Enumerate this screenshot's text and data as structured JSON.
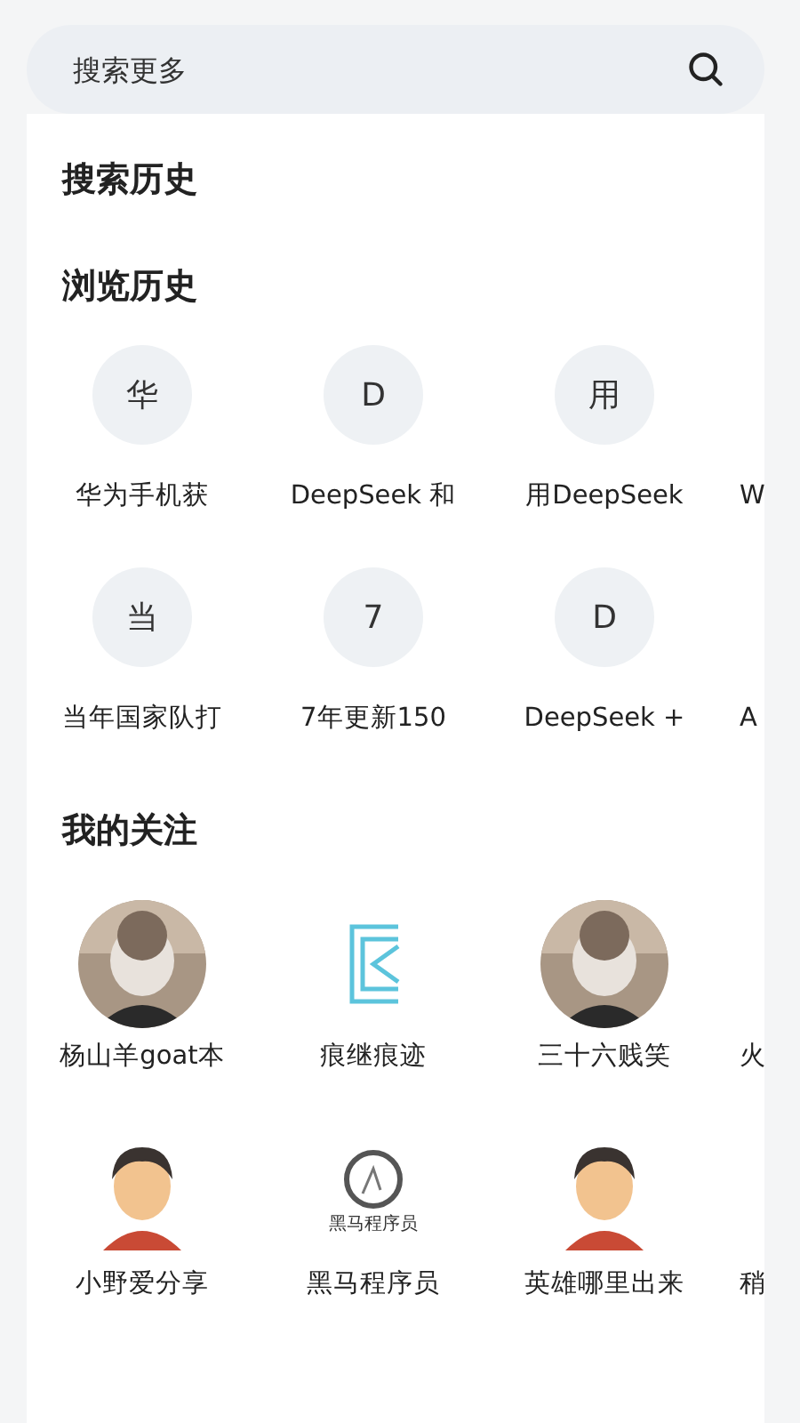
{
  "search": {
    "placeholder": "搜索更多"
  },
  "search_history": {
    "title": "搜索历史"
  },
  "browse_history": {
    "title": "浏览历史",
    "rows": [
      [
        {
          "initial": "华",
          "label": "华为手机获"
        },
        {
          "initial": "D",
          "label": "DeepSeek 和"
        },
        {
          "initial": "用",
          "label": "用DeepSeek"
        },
        {
          "label": "W"
        }
      ],
      [
        {
          "initial": "当",
          "label": "当年国家队打"
        },
        {
          "initial": "7",
          "label": "7年更新150"
        },
        {
          "initial": "D",
          "label": "DeepSeek +"
        },
        {
          "label": "A"
        }
      ]
    ]
  },
  "following": {
    "title": "我的关注",
    "rows": [
      [
        {
          "name": "杨山羊goat本"
        },
        {
          "kind": "bracket-logo",
          "name": "痕继痕迹"
        },
        {
          "name": "三十六贱笑"
        },
        {
          "kind": "none",
          "name": "火"
        }
      ],
      [
        {
          "kind": "cartoon",
          "name": "小野爱分享"
        },
        {
          "kind": "ring-logo",
          "name": "黑马程序员",
          "logo_text": "黑马程序员"
        },
        {
          "kind": "cartoon",
          "name": "英雄哪里出来"
        },
        {
          "kind": "none",
          "name": "稍"
        }
      ]
    ]
  }
}
